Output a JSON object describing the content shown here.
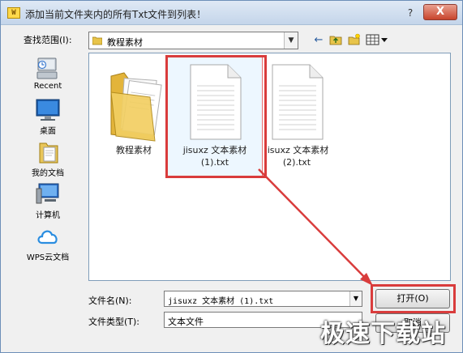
{
  "window": {
    "title": "添加当前文件夹内的所有Txt文件到列表！",
    "app_icon_text": "W",
    "help_label": "?",
    "close_label": "X"
  },
  "lookin": {
    "label": "查找范围(I):",
    "value": "教程素材"
  },
  "toolbar": {
    "back_icon": "←",
    "up_icon": "↑",
    "new_folder_icon": "✱",
    "view_menu_icon": "▦▾"
  },
  "places": [
    {
      "label": "Recent",
      "icon": "recent-places-icon"
    },
    {
      "label": "桌面",
      "icon": "desktop-icon"
    },
    {
      "label": "我的文档",
      "icon": "documents-icon"
    },
    {
      "label": "计算机",
      "icon": "computer-icon"
    },
    {
      "label": "WPS云文档",
      "icon": "cloud-icon"
    }
  ],
  "files": [
    {
      "name": "教程素材",
      "type": "folder"
    },
    {
      "name": "jisuxz 文本素材 (1).txt",
      "type": "txt",
      "selected": true
    },
    {
      "name": "jisuxz 文本素材 (2).txt",
      "type": "txt"
    }
  ],
  "filename": {
    "label": "文件名(N):",
    "value": "jisuxz 文本素材 (1).txt"
  },
  "filetype": {
    "label": "文件类型(T):",
    "value": "文本文件"
  },
  "buttons": {
    "open": "打开(O)",
    "cancel": "取消"
  },
  "watermark": "极速下载站",
  "colors": {
    "annotation": "#d93c3c",
    "selection": "#cce8ff"
  }
}
